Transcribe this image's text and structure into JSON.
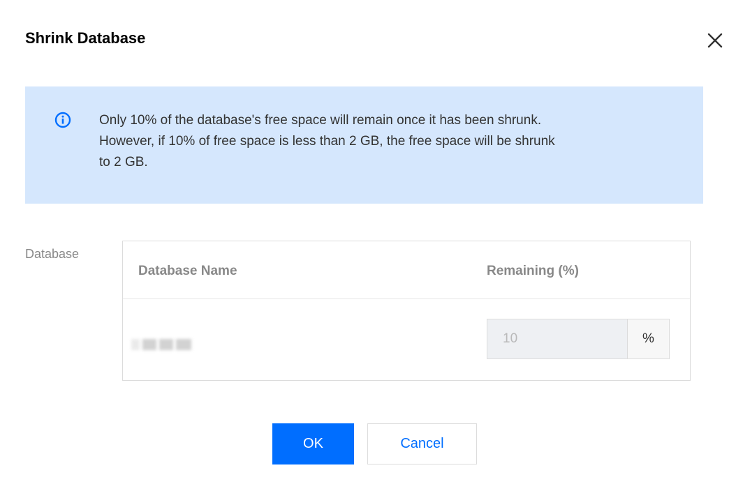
{
  "dialog": {
    "title": "Shrink Database",
    "close_icon": "close-icon"
  },
  "notice": {
    "icon": "info-circle-icon",
    "lines": [
      "Only 10% of the database's free space will remain once it has been shrunk.",
      "However, if 10% of free space is less than 2 GB, the free space will be shrunk",
      "to 2 GB."
    ],
    "background_color": "#d5e7fd",
    "icon_color": "#006eff"
  },
  "database": {
    "label": "Database",
    "columns": [
      "Database Name",
      "Remaining (%)"
    ],
    "rows": [
      {
        "name": "",
        "remaining": "10",
        "unit": "%"
      }
    ]
  },
  "buttons": {
    "ok": "OK",
    "cancel": "Cancel"
  },
  "colors": {
    "primary": "#006eff"
  }
}
